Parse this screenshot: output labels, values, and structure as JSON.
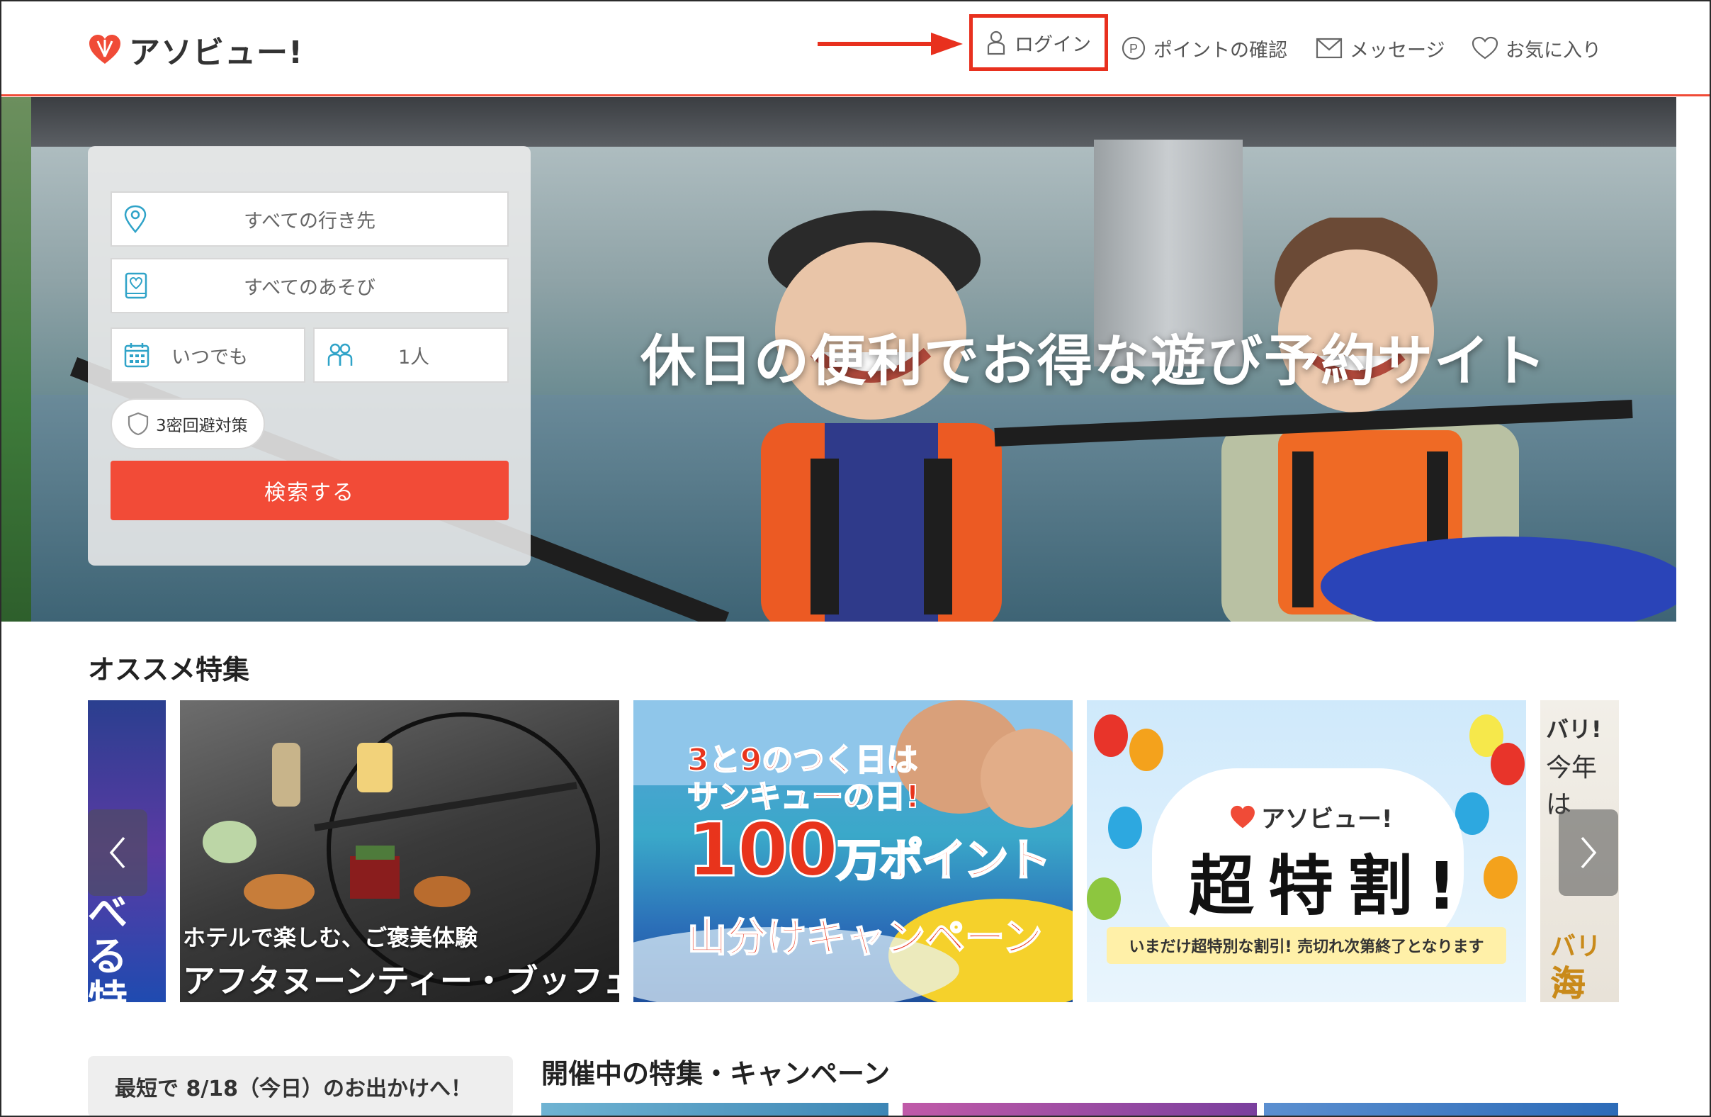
{
  "header": {
    "logo_text": "アソビュー!",
    "nav": {
      "login": "ログイン",
      "points": "ポイントの確認",
      "messages": "メッセージ",
      "favorites": "お気に入り"
    }
  },
  "hero": {
    "title": "休日の便利でお得な遊び予約サイト",
    "search": {
      "destination_placeholder": "すべての行き先",
      "activity_placeholder": "すべてのあそび",
      "date_value": "いつでも",
      "people_value": "1人",
      "safety_chip": "3密回避対策",
      "search_button": "検索する"
    }
  },
  "featured": {
    "title": "オススメ特集",
    "cards": [
      {
        "text": "べる\n特集"
      },
      {
        "subtitle": "ホテルで楽しむ、ご褒美体験",
        "title": "アフタヌーンティー・ブッフェ"
      },
      {
        "line1": "3と9のつく日は",
        "line2": "サンキューの日!",
        "line3_num": "100",
        "line3_unit": "万ポイント",
        "line4": "山分けキャンペーン"
      },
      {
        "brand": "アソビュー!",
        "title": "超特割!",
        "ribbon": "いまだけ超特別な割引! 売切れ次第終了となります"
      },
      {
        "line1": "バリ!",
        "line2": "今年は",
        "line3": "バリこ",
        "line4": "海タ"
      }
    ]
  },
  "bottom": {
    "soonest_label": "最短で 8/18（今日）のお出かけへ！",
    "campaigns_title": "開催中の特集・キャンペーン"
  },
  "colors": {
    "brand_red": "#f24b37",
    "highlight_red": "#e8301e"
  }
}
